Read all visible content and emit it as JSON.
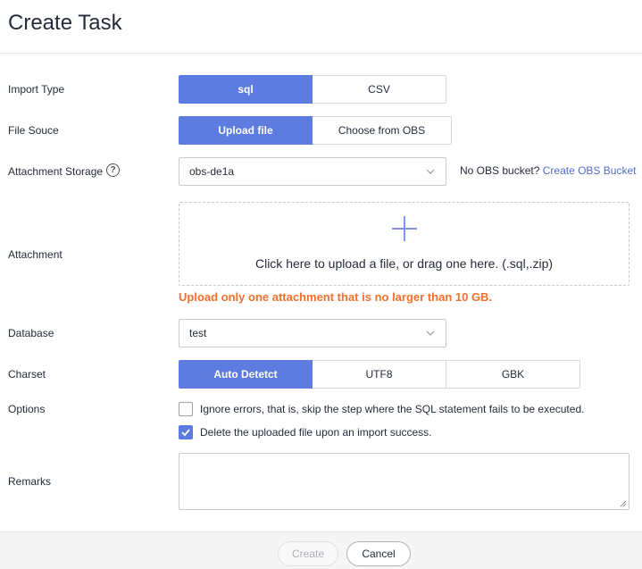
{
  "dialog": {
    "title": "Create Task"
  },
  "import_type": {
    "label": "Import Type",
    "options": [
      "sql",
      "CSV"
    ],
    "selected": "sql"
  },
  "file_source": {
    "label": "File Souce",
    "options": [
      "Upload file",
      "Choose from OBS"
    ],
    "selected": "Upload file"
  },
  "attachment_storage": {
    "label": "Attachment Storage",
    "value": "obs-de1a",
    "hint_text": "No OBS bucket?",
    "hint_link": "Create OBS Bucket"
  },
  "attachment": {
    "label": "Attachment",
    "drop_text": "Click here to upload a file, or drag one here. (.sql,.zip)",
    "warning": "Upload only one attachment that is no larger than 10 GB."
  },
  "database": {
    "label": "Database",
    "value": "test"
  },
  "charset": {
    "label": "Charset",
    "options": [
      "Auto Detetct",
      "UTF8",
      "GBK"
    ],
    "selected": "Auto Detetct"
  },
  "options": {
    "label": "Options",
    "items": [
      {
        "label": "Ignore errors, that is, skip the step where the SQL statement fails to be executed.",
        "checked": false
      },
      {
        "label": "Delete the uploaded file upon an import success.",
        "checked": true
      }
    ]
  },
  "remarks": {
    "label": "Remarks",
    "value": ""
  },
  "footer": {
    "create_label": "Create",
    "cancel_label": "Cancel"
  },
  "colors": {
    "primary": "#5e7ce0",
    "link": "#526ecc",
    "warning": "#f66f2b"
  }
}
